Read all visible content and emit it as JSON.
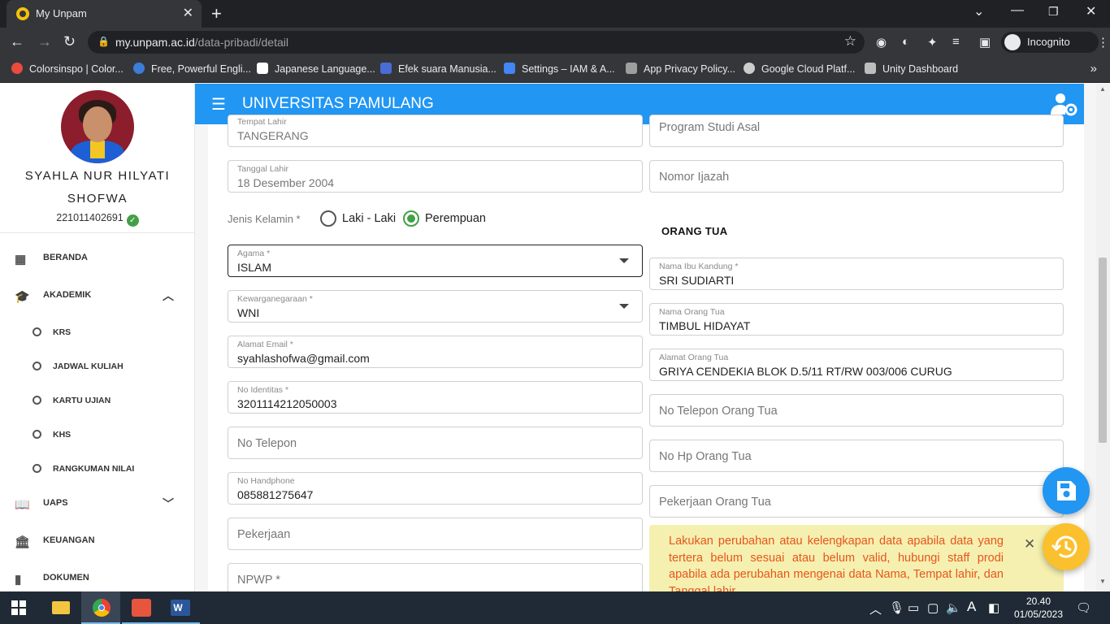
{
  "browser": {
    "tab_title": "My Unpam",
    "tab_close": "✕",
    "new_tab": "+",
    "url_host": "my.unpam.ac.id",
    "url_path": "/data-pribadi/detail",
    "incognito_label": "Incognito",
    "bookmarks": [
      {
        "label": "Colorsinspo | Color...",
        "color": "#e94b3c"
      },
      {
        "label": "Free, Powerful Engli...",
        "color": "#3b7dd8"
      },
      {
        "label": "Japanese Language...",
        "color": "#ffffff"
      },
      {
        "label": "Efek suara Manusia...",
        "color": "#4a6cd4"
      },
      {
        "label": "Settings – IAM & A...",
        "color": "#4285f4"
      },
      {
        "label": "App Privacy Policy...",
        "color": "#9e9e9e"
      },
      {
        "label": "Google Cloud Platf...",
        "color": "#cccccc"
      },
      {
        "label": "Unity Dashboard",
        "color": "#bdbdbd"
      }
    ]
  },
  "sidebar": {
    "user_name": "SYAHLA NUR HILYATI SHOFWA",
    "nim": "221011402691",
    "menu": {
      "beranda": "BERANDA",
      "akademik": "AKADEMIK",
      "krs": "KRS",
      "jadwal": "JADWAL KULIAH",
      "kartu": "KARTU UJIAN",
      "khs": "KHS",
      "rangkuman": "RANGKUMAN NILAI",
      "uaps": "UAPS",
      "keuangan": "KEUANGAN",
      "dokumen": "DOKUMEN"
    }
  },
  "appbar": {
    "title": "UNIVERSITAS PAMULANG"
  },
  "form": {
    "tempat_lahir": {
      "label": "Tempat Lahir",
      "value": "TANGERANG"
    },
    "tanggal_lahir": {
      "label": "Tanggal Lahir",
      "value": "18 Desember 2004"
    },
    "jenis_kelamin": {
      "label": "Jenis Kelamin *",
      "option_male": "Laki - Laki",
      "option_female": "Perempuan",
      "selected": "Perempuan"
    },
    "agama": {
      "label": "Agama *",
      "value": "ISLAM"
    },
    "kewarganegaraan": {
      "label": "Kewarganegaraan *",
      "value": "WNI"
    },
    "email": {
      "label": "Alamat Email *",
      "value": "syahlashofwa@gmail.com"
    },
    "no_identitas": {
      "label": "No Identitas *",
      "value": "3201114212050003"
    },
    "no_telepon": {
      "placeholder": "No Telepon"
    },
    "no_handphone": {
      "label": "No Handphone",
      "value": "085881275647"
    },
    "pekerjaan": {
      "placeholder": "Pekerjaan"
    },
    "npwp": {
      "placeholder": "NPWP *"
    },
    "program_studi_asal": {
      "placeholder": "Program Studi Asal"
    },
    "nomor_ijazah": {
      "placeholder": "Nomor Ijazah"
    },
    "orang_tua_title": "ORANG TUA",
    "nama_ibu": {
      "label": "Nama Ibu Kandung *",
      "value": "SRI SUDIARTI"
    },
    "nama_orang_tua": {
      "label": "Nama Orang Tua",
      "value": "TIMBUL HIDAYAT"
    },
    "alamat_orang_tua": {
      "label": "Alamat Orang Tua",
      "value": "GRIYA CENDEKIA BLOK D.5/11 RT/RW 003/006 CURUG"
    },
    "telepon_orang_tua": {
      "placeholder": "No Telepon Orang Tua"
    },
    "hp_orang_tua": {
      "placeholder": "No Hp Orang Tua"
    },
    "pekerjaan_orang_tua": {
      "placeholder": "Pekerjaan Orang Tua"
    }
  },
  "notice": {
    "text": "Lakukan perubahan atau kelengkapan data apabila data yang tertera belum sesuai atau belum valid, hubungi staff prodi apabila ada perubahan mengenai data Nama, Tempat lahir, dan Tanggal lahir."
  },
  "taskbar": {
    "time": "20.40",
    "date": "01/05/2023"
  }
}
